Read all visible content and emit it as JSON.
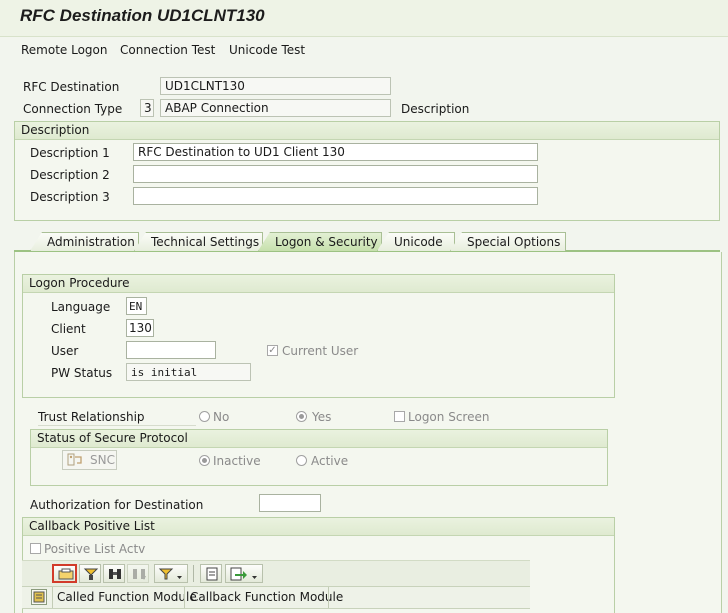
{
  "window": {
    "title": "RFC Destination UD1CLNT130"
  },
  "menu": {
    "items": [
      "Remote Logon",
      "Connection Test",
      "Unicode Test"
    ]
  },
  "header": {
    "rfc_destination_label": "RFC Destination",
    "rfc_destination_value": "UD1CLNT130",
    "connection_type_label": "Connection Type",
    "connection_type_code": "3",
    "connection_type_value": "ABAP Connection",
    "description_label": "Description"
  },
  "description_group": {
    "title": "Description",
    "rows": [
      {
        "label": "Description 1",
        "value": "RFC Destination to UD1 Client 130"
      },
      {
        "label": "Description 2",
        "value": ""
      },
      {
        "label": "Description 3",
        "value": ""
      }
    ]
  },
  "tabs": [
    {
      "label": "Administration",
      "active": false
    },
    {
      "label": "Technical Settings",
      "active": false
    },
    {
      "label": "Logon & Security",
      "active": true
    },
    {
      "label": "Unicode",
      "active": false
    },
    {
      "label": "Special Options",
      "active": false
    }
  ],
  "logon_procedure": {
    "title": "Logon Procedure",
    "language_label": "Language",
    "language_value": "EN",
    "client_label": "Client",
    "client_value": "130",
    "user_label": "User",
    "user_value": "",
    "current_user_label": "Current User",
    "current_user_checked": true,
    "pw_status_label": "PW Status",
    "pw_status_value": "is initial"
  },
  "trust": {
    "label": "Trust Relationship",
    "option_no": "No",
    "option_yes": "Yes",
    "selected": "Yes",
    "logon_screen_label": "Logon Screen",
    "logon_screen_checked": false
  },
  "secure_protocol": {
    "title": "Status of Secure Protocol",
    "snc_button": "SNC",
    "option_inactive": "Inactive",
    "option_active": "Active",
    "selected": "Inactive"
  },
  "authorization": {
    "label": "Authorization for Destination",
    "value": ""
  },
  "callback": {
    "title": "Callback Positive List",
    "positive_list_label": "Positive List Actv",
    "positive_list_checked": false,
    "columns": [
      "Called Function Module",
      "Callback Function Module"
    ]
  },
  "colors": {
    "accent_green": "#9cc283",
    "group_border": "#b9cfa6",
    "background": "#f2f5ee"
  }
}
